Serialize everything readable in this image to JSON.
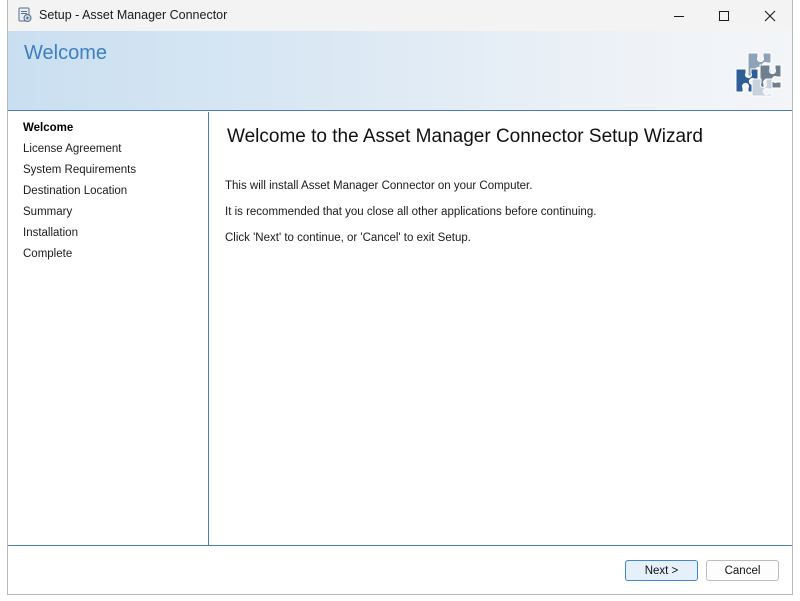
{
  "window": {
    "title": "Setup - Asset Manager Connector"
  },
  "header": {
    "title": "Welcome",
    "logo_icon": "puzzle-pieces-icon"
  },
  "sidebar": {
    "items": [
      {
        "label": "Welcome",
        "active": true
      },
      {
        "label": "License Agreement",
        "active": false
      },
      {
        "label": "System Requirements",
        "active": false
      },
      {
        "label": "Destination Location",
        "active": false
      },
      {
        "label": "Summary",
        "active": false
      },
      {
        "label": "Installation",
        "active": false
      },
      {
        "label": "Complete",
        "active": false
      }
    ]
  },
  "content": {
    "title": "Welcome to the Asset Manager Connector Setup Wizard",
    "paragraphs": [
      "This will install Asset Manager Connector on your Computer.",
      "It is recommended that you close all other applications before continuing.",
      "Click 'Next' to continue, or 'Cancel' to exit Setup."
    ]
  },
  "footer": {
    "next_label": "Next >",
    "cancel_label": "Cancel"
  },
  "colors": {
    "accent": "#3d7fc1",
    "divider": "#4c7db1"
  }
}
